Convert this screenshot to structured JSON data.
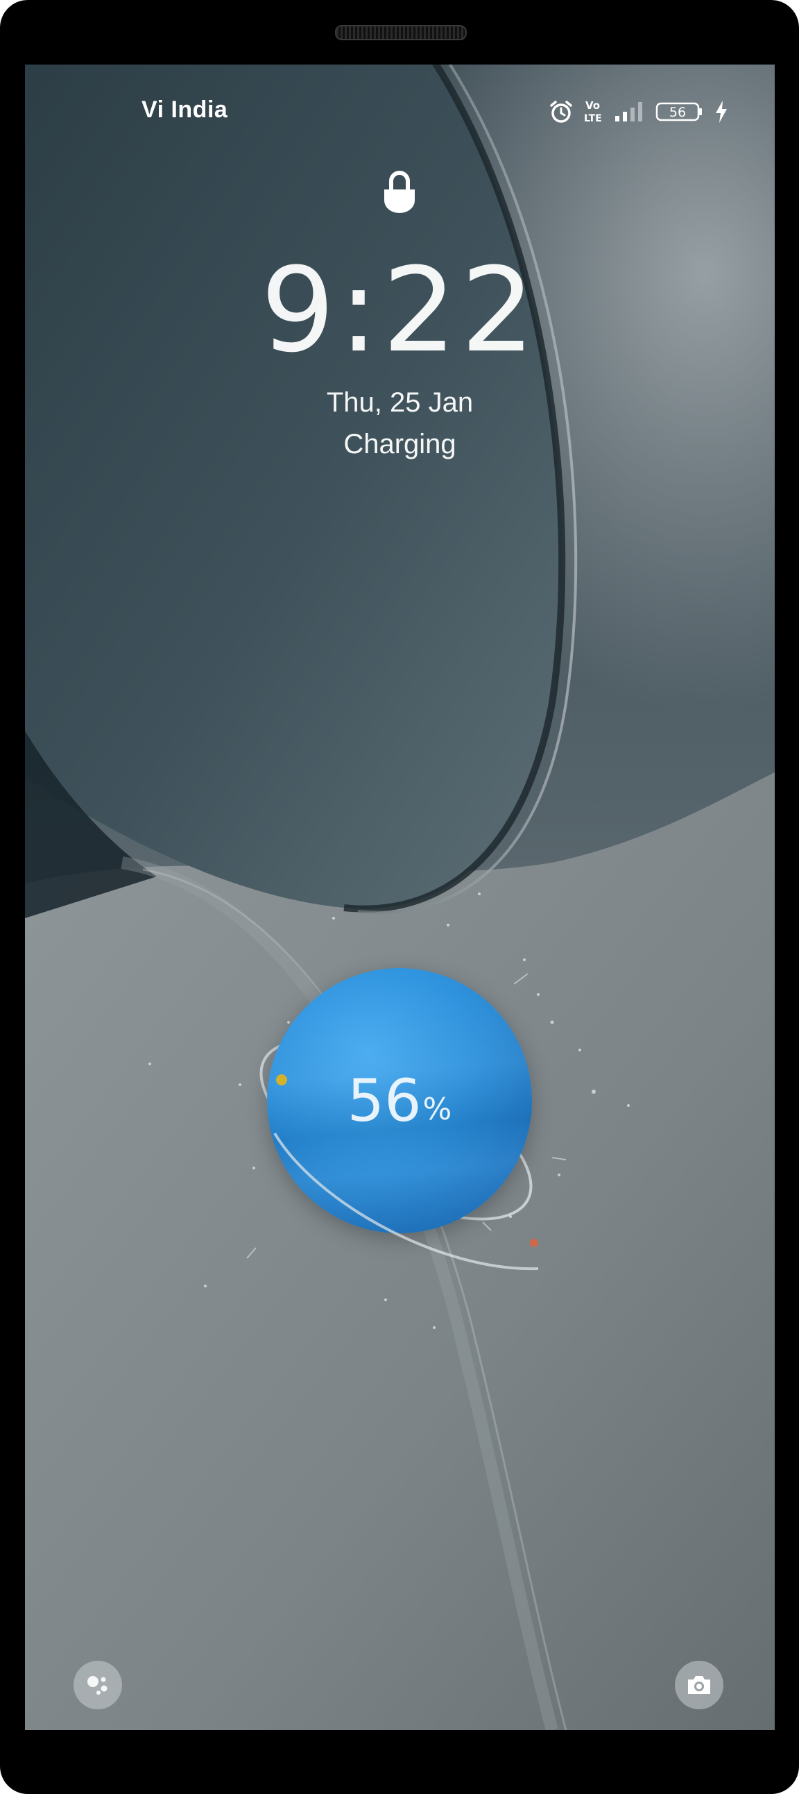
{
  "status_bar": {
    "carrier": "Vi India",
    "network_label_top": "Vo",
    "network_label_bottom": "LTE",
    "battery_level": "56",
    "icons": [
      "alarm-icon",
      "volte-icon",
      "signal-icon",
      "battery-icon",
      "charging-bolt-icon"
    ]
  },
  "lock_screen": {
    "time": "9:22",
    "date": "Thu, 25 Jan",
    "status": "Charging"
  },
  "charging_widget": {
    "percent_value": "56",
    "percent_sign": "%",
    "fraction": 0.56
  },
  "shortcuts": {
    "left_icon": "assistant-icon",
    "right_icon": "camera-icon"
  }
}
